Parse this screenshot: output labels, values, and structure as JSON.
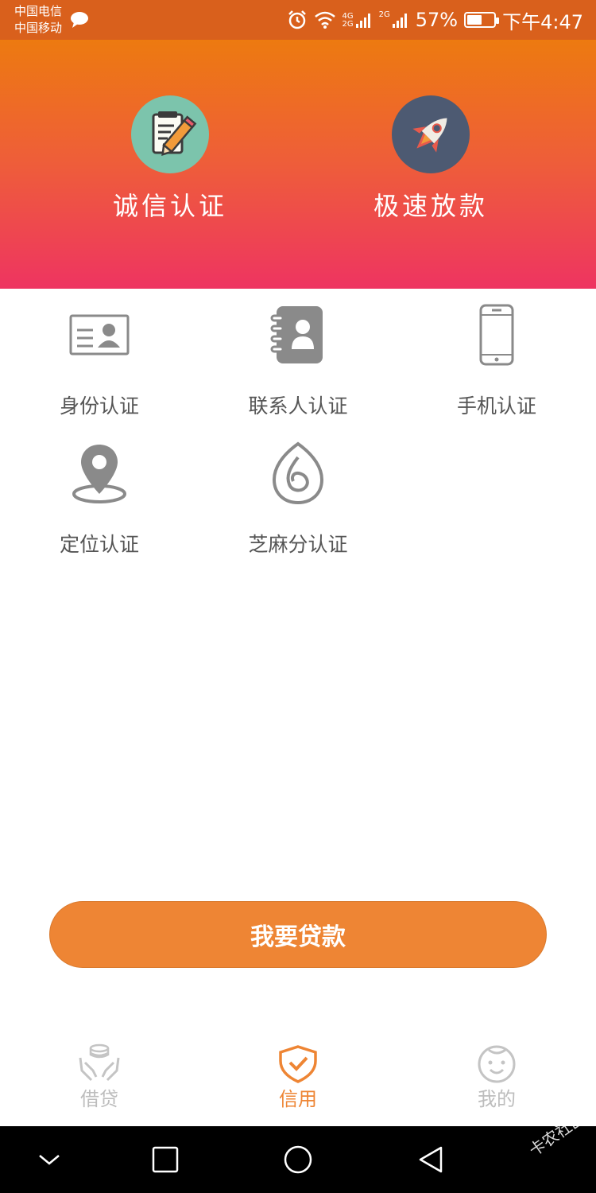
{
  "status_bar": {
    "carrier_1": "中国电信",
    "carrier_2": "中国移动",
    "network_1": "4G",
    "network_1b": "2G",
    "network_2": "2G",
    "battery": "57%",
    "battery_level": 0.57,
    "time": "下午4:47"
  },
  "hero": {
    "items": [
      {
        "label": "诚信认证",
        "icon": "notepad-pencil-icon"
      },
      {
        "label": "极速放款",
        "icon": "rocket-icon"
      }
    ]
  },
  "certifications": [
    {
      "label": "身份认证",
      "icon": "id-card-icon"
    },
    {
      "label": "联系人认证",
      "icon": "contacts-book-icon"
    },
    {
      "label": "手机认证",
      "icon": "mobile-phone-icon"
    },
    {
      "label": "定位认证",
      "icon": "location-pin-icon"
    },
    {
      "label": "芝麻分认证",
      "icon": "sesame-icon"
    }
  ],
  "loan_button": {
    "label": "我要贷款"
  },
  "tabs": [
    {
      "label": "借贷",
      "icon": "hands-coins-icon",
      "active": false
    },
    {
      "label": "信用",
      "icon": "shield-check-icon",
      "active": true
    },
    {
      "label": "我的",
      "icon": "smiley-face-icon",
      "active": false
    }
  ],
  "colors": {
    "accent": "#ee8534",
    "status_bar": "#d9601c",
    "hero_top": "#ed7a10",
    "hero_bottom": "#ee3461",
    "icon_gray": "#8a8a8a"
  },
  "watermark": "卡农社区"
}
